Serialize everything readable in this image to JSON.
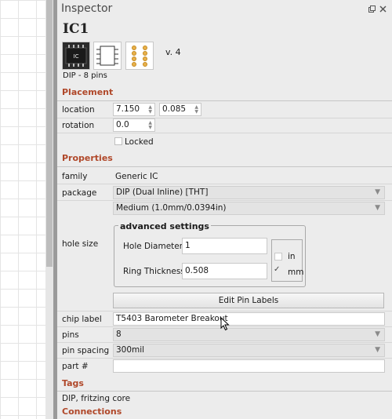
{
  "inspector": {
    "title": "Inspector",
    "part_title": "IC1",
    "thumbnail_label": "IC",
    "version": "v. 4",
    "caption": "DIP - 8 pins"
  },
  "placement": {
    "section": "Placement",
    "location_label": "location",
    "location_x": "7.150",
    "location_y": "0.085",
    "rotation_label": "rotation",
    "rotation_value": "0.0",
    "locked_label": "Locked"
  },
  "properties": {
    "section": "Properties",
    "family_label": "family",
    "family_value": "Generic IC",
    "package_label": "package",
    "package_value": "DIP (Dual Inline) [THT]",
    "hole_size_label": "hole size",
    "hole_size_value": "Medium (1.0mm/0.0394in)",
    "advanced_title": "advanced settings",
    "hole_diameter_label": "Hole Diameter",
    "hole_diameter_value": "1",
    "ring_thickness_label": "Ring Thickness",
    "ring_thickness_value": "0.508",
    "unit_in": "in",
    "unit_mm": "mm",
    "unit_selected": "mm",
    "edit_pin_labels": "Edit Pin Labels",
    "chip_label_label": "chip label",
    "chip_label_value": "T5403 Barometer Breakout",
    "pins_label": "pins",
    "pins_value": "8",
    "pin_spacing_label": "pin spacing",
    "pin_spacing_value": "300mil",
    "part_number_label": "part #",
    "part_number_value": ""
  },
  "tags": {
    "section": "Tags",
    "value": "DIP, fritzing core"
  },
  "connections": {
    "section": "Connections"
  },
  "colors": {
    "section_title": "#b0482a",
    "panel_bg": "#ececec"
  }
}
